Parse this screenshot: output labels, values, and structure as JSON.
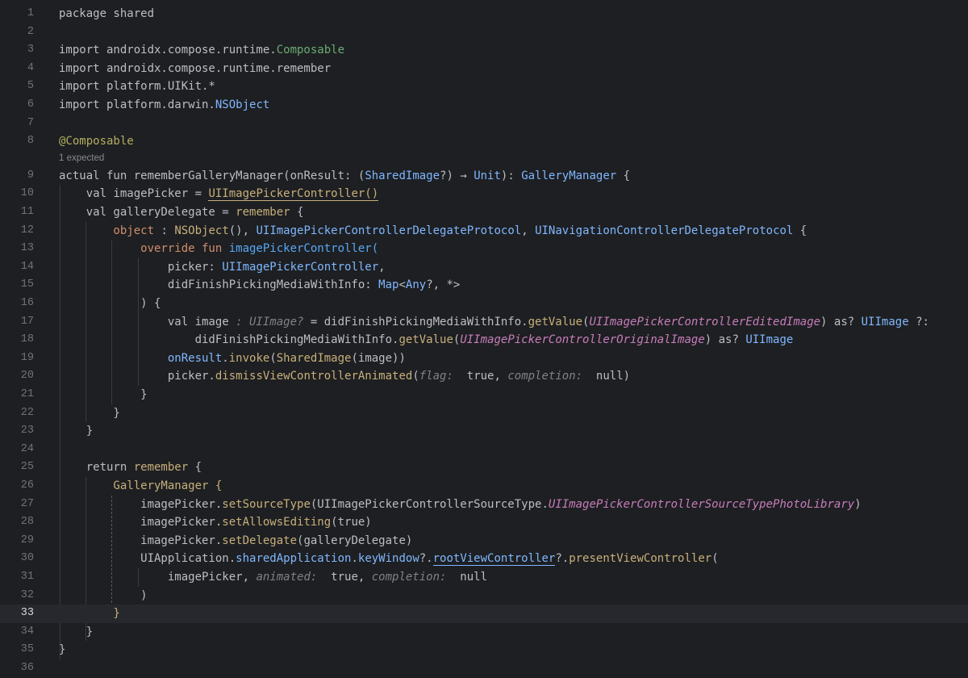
{
  "editor": {
    "inlay_hint": "1 expected",
    "current_line": 33,
    "lines": [
      {
        "n": "1",
        "tokens": [
          {
            "t": "package shared",
            "c": ""
          }
        ]
      },
      {
        "n": "2",
        "tokens": []
      },
      {
        "n": "3",
        "tokens": [
          {
            "t": "import androidx.compose.runtime.",
            "c": ""
          },
          {
            "t": "Composable",
            "c": "im"
          }
        ]
      },
      {
        "n": "4",
        "tokens": [
          {
            "t": "import androidx.compose.runtime.remember",
            "c": ""
          }
        ]
      },
      {
        "n": "5",
        "tokens": [
          {
            "t": "import platform.UIKit.*",
            "c": ""
          }
        ]
      },
      {
        "n": "6",
        "tokens": [
          {
            "t": "import platform.darwin.",
            "c": ""
          },
          {
            "t": "NSObject",
            "c": "cls"
          }
        ]
      },
      {
        "n": "7",
        "tokens": []
      },
      {
        "n": "8",
        "tokens": [
          {
            "t": "@Composable",
            "c": "ann"
          }
        ]
      },
      {
        "n": "9",
        "tokens": [
          {
            "t": "actual fun ",
            "c": ""
          },
          {
            "t": "rememberGalleryManager",
            "c": ""
          },
          {
            "t": "(onResult: (",
            "c": ""
          },
          {
            "t": "SharedImage",
            "c": "cls"
          },
          {
            "t": "?) → ",
            "c": ""
          },
          {
            "t": "Unit",
            "c": "cls"
          },
          {
            "t": "): ",
            "c": ""
          },
          {
            "t": "GalleryManager",
            "c": "cls"
          },
          {
            "t": " {",
            "c": ""
          }
        ]
      },
      {
        "n": "10",
        "tokens": [
          {
            "t": "    val imagePicker = ",
            "c": ""
          },
          {
            "t": "UIImagePickerController()",
            "c": "m underline"
          }
        ]
      },
      {
        "n": "11",
        "tokens": [
          {
            "t": "    val galleryDelegate = ",
            "c": ""
          },
          {
            "t": "remember",
            "c": "m"
          },
          {
            "t": " {",
            "c": ""
          }
        ]
      },
      {
        "n": "12",
        "tokens": [
          {
            "t": "        object",
            "c": "k"
          },
          {
            "t": " : ",
            "c": ""
          },
          {
            "t": "NSObject",
            "c": "m"
          },
          {
            "t": "(), ",
            "c": ""
          },
          {
            "t": "UIImagePickerControllerDelegateProtocol",
            "c": "cls"
          },
          {
            "t": ", ",
            "c": ""
          },
          {
            "t": "UINavigationControllerDelegateProtocol",
            "c": "cls"
          },
          {
            "t": " {",
            "c": ""
          }
        ]
      },
      {
        "n": "13",
        "tokens": [
          {
            "t": "            override fun ",
            "c": "k"
          },
          {
            "t": "imagePickerController(",
            "c": "fn"
          }
        ]
      },
      {
        "n": "14",
        "tokens": [
          {
            "t": "                picker: ",
            "c": ""
          },
          {
            "t": "UIImagePickerController",
            "c": "cls"
          },
          {
            "t": ",",
            "c": ""
          }
        ]
      },
      {
        "n": "15",
        "tokens": [
          {
            "t": "                didFinishPickingMediaWithInfo: ",
            "c": ""
          },
          {
            "t": "Map",
            "c": "cls"
          },
          {
            "t": "<",
            "c": ""
          },
          {
            "t": "Any",
            "c": "cls"
          },
          {
            "t": "?, *>",
            "c": ""
          }
        ]
      },
      {
        "n": "16",
        "tokens": [
          {
            "t": "            ) {",
            "c": ""
          }
        ]
      },
      {
        "n": "17",
        "tokens": [
          {
            "t": "                val image",
            "c": ""
          },
          {
            "t": " : UIImage? ",
            "c": "hint"
          },
          {
            "t": "= didFinishPickingMediaWithInfo.",
            "c": ""
          },
          {
            "t": "getValue",
            "c": "m"
          },
          {
            "t": "(",
            "c": ""
          },
          {
            "t": "UIImagePickerControllerEditedImage",
            "c": "ital"
          },
          {
            "t": ") as? ",
            "c": ""
          },
          {
            "t": "UIImage",
            "c": "cls"
          },
          {
            "t": " ?:",
            "c": ""
          }
        ]
      },
      {
        "n": "18",
        "tokens": [
          {
            "t": "                    didFinishPickingMediaWithInfo.",
            "c": ""
          },
          {
            "t": "getValue",
            "c": "m"
          },
          {
            "t": "(",
            "c": ""
          },
          {
            "t": "UIImagePickerControllerOriginalImage",
            "c": "ital"
          },
          {
            "t": ") as? ",
            "c": ""
          },
          {
            "t": "UIImage",
            "c": "cls"
          }
        ]
      },
      {
        "n": "19",
        "tokens": [
          {
            "t": "                onResult",
            "c": "cls"
          },
          {
            "t": ".",
            "c": ""
          },
          {
            "t": "invoke",
            "c": "m"
          },
          {
            "t": "(",
            "c": ""
          },
          {
            "t": "SharedImage",
            "c": "m"
          },
          {
            "t": "(image))",
            "c": ""
          }
        ]
      },
      {
        "n": "20",
        "tokens": [
          {
            "t": "                picker.",
            "c": ""
          },
          {
            "t": "dismissViewControllerAnimated",
            "c": "m"
          },
          {
            "t": "(",
            "c": ""
          },
          {
            "t": "flag:",
            "c": "hint"
          },
          {
            "t": "  true, ",
            "c": ""
          },
          {
            "t": "completion:",
            "c": "hint"
          },
          {
            "t": "  null)",
            "c": ""
          }
        ]
      },
      {
        "n": "21",
        "tokens": [
          {
            "t": "            }",
            "c": ""
          }
        ]
      },
      {
        "n": "22",
        "tokens": [
          {
            "t": "        }",
            "c": ""
          }
        ]
      },
      {
        "n": "23",
        "tokens": [
          {
            "t": "    }",
            "c": ""
          }
        ]
      },
      {
        "n": "24",
        "tokens": []
      },
      {
        "n": "25",
        "tokens": [
          {
            "t": "    return ",
            "c": ""
          },
          {
            "t": "remember",
            "c": "m"
          },
          {
            "t": " {",
            "c": ""
          }
        ]
      },
      {
        "n": "26",
        "tokens": [
          {
            "t": "        GalleryManager",
            "c": "m"
          },
          {
            "t": " {",
            "c": "m"
          }
        ]
      },
      {
        "n": "27",
        "tokens": [
          {
            "t": "            imagePicker.",
            "c": ""
          },
          {
            "t": "setSourceType",
            "c": "m"
          },
          {
            "t": "(UIImagePickerControllerSourceType.",
            "c": ""
          },
          {
            "t": "UIImagePickerControllerSourceTypePhotoLibrary",
            "c": "ital"
          },
          {
            "t": ")",
            "c": ""
          }
        ]
      },
      {
        "n": "28",
        "tokens": [
          {
            "t": "            imagePicker.",
            "c": ""
          },
          {
            "t": "setAllowsEditing",
            "c": "m"
          },
          {
            "t": "(true)",
            "c": ""
          }
        ]
      },
      {
        "n": "29",
        "tokens": [
          {
            "t": "            imagePicker.",
            "c": ""
          },
          {
            "t": "setDelegate",
            "c": "m"
          },
          {
            "t": "(galleryDelegate)",
            "c": ""
          }
        ]
      },
      {
        "n": "30",
        "tokens": [
          {
            "t": "            UIApplication.",
            "c": ""
          },
          {
            "t": "sharedApplication",
            "c": "cls"
          },
          {
            "t": ".",
            "c": ""
          },
          {
            "t": "keyWindow",
            "c": "cls"
          },
          {
            "t": "?.",
            "c": ""
          },
          {
            "t": "rootViewController",
            "c": "cls underline2"
          },
          {
            "t": "?.",
            "c": ""
          },
          {
            "t": "presentViewController",
            "c": "m"
          },
          {
            "t": "(",
            "c": ""
          }
        ]
      },
      {
        "n": "31",
        "tokens": [
          {
            "t": "                imagePicker, ",
            "c": ""
          },
          {
            "t": "animated:",
            "c": "hint"
          },
          {
            "t": "  true, ",
            "c": ""
          },
          {
            "t": "completion:",
            "c": "hint"
          },
          {
            "t": "  null",
            "c": ""
          }
        ]
      },
      {
        "n": "32",
        "tokens": [
          {
            "t": "            )",
            "c": ""
          }
        ]
      },
      {
        "n": "33",
        "tokens": [
          {
            "t": "        }",
            "c": "m"
          }
        ]
      },
      {
        "n": "34",
        "tokens": [
          {
            "t": "    }",
            "c": ""
          }
        ]
      },
      {
        "n": "35",
        "tokens": [
          {
            "t": "}",
            "c": ""
          }
        ]
      },
      {
        "n": "36",
        "tokens": []
      }
    ]
  }
}
